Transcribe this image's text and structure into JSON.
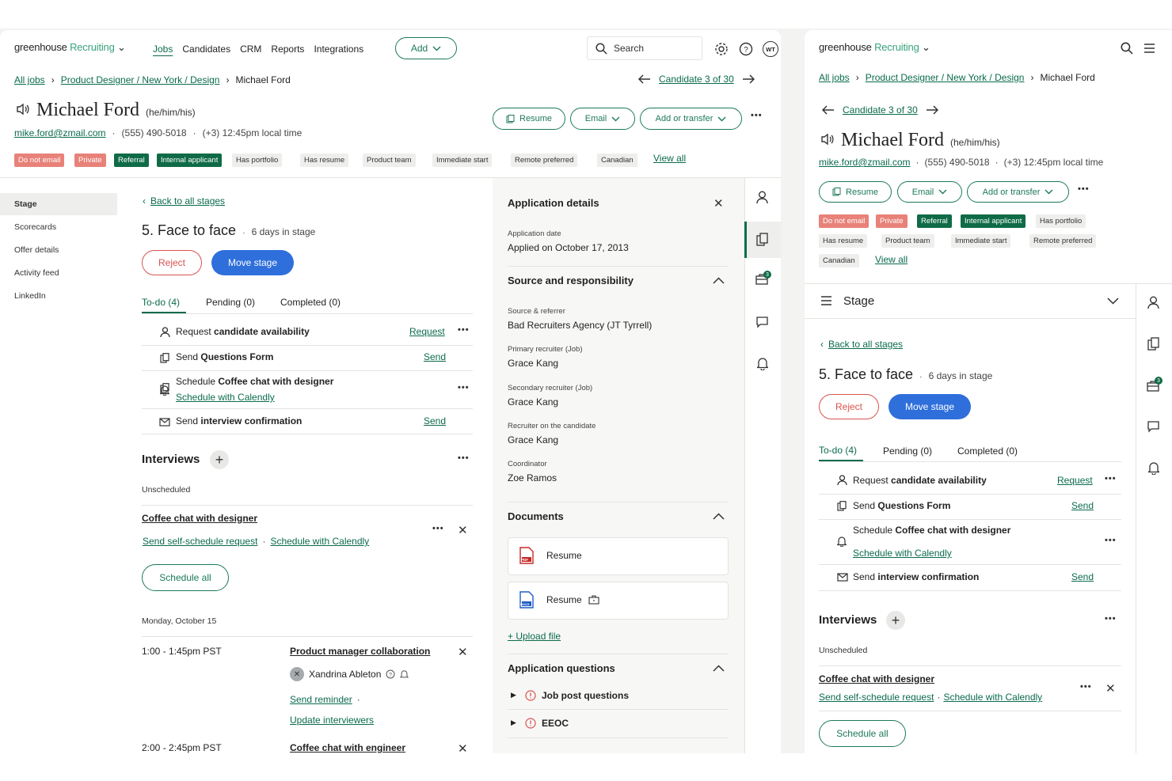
{
  "app": {
    "brand": "greenhouse",
    "product": "Recruiting"
  },
  "nav": {
    "jobs": "Jobs",
    "candidates": "Candidates",
    "crm": "CRM",
    "reports": "Reports",
    "integrations": "Integrations",
    "add": "Add",
    "search_placeholder": "Search",
    "user_initials": "WT"
  },
  "breadcrumb": {
    "all_jobs": "All jobs",
    "job": "Product Designer / New York / Design",
    "current": "Michael Ford"
  },
  "pager": {
    "label": "Candidate 3 of 30"
  },
  "candidate": {
    "name": "Michael Ford",
    "pronouns": "(he/him/his)",
    "email": "mike.ford@zmail.com",
    "phone": "(555) 490-5018",
    "local_time": "(+3) 12:45pm local time",
    "sep": "·"
  },
  "actions": {
    "resume": "Resume",
    "email": "Email",
    "add_transfer": "Add or transfer",
    "more": "•••"
  },
  "tags": [
    {
      "label": "Do not email",
      "style": "red"
    },
    {
      "label": "Private",
      "style": "red"
    },
    {
      "label": "Referral",
      "style": "green"
    },
    {
      "label": "Internal applicant",
      "style": "green"
    },
    {
      "label": "Has portfolio",
      "style": "gray"
    },
    {
      "label": "Has resume",
      "style": "gray"
    },
    {
      "label": "Product team",
      "style": "gray"
    },
    {
      "label": "Immediate start",
      "style": "gray"
    },
    {
      "label": "Remote preferred",
      "style": "gray"
    },
    {
      "label": "Canadian",
      "style": "gray"
    }
  ],
  "view_all": "View all",
  "sidebar": {
    "items": [
      "Stage",
      "Scorecards",
      "Offer details",
      "Activity feed",
      "LinkedIn"
    ]
  },
  "stage": {
    "back": "Back to all stages",
    "title": "5. Face to face",
    "days": "6 days in stage",
    "reject": "Reject",
    "move": "Move stage",
    "section": "Stage"
  },
  "tabs": {
    "todo": "To-do (4)",
    "pending": "Pending (0)",
    "completed": "Completed (0)"
  },
  "todos": [
    {
      "pre": "Request ",
      "bold": "candidate availability",
      "action": "Request"
    },
    {
      "pre": "Send ",
      "bold": "Questions Form",
      "action": "Send"
    },
    {
      "pre": "Schedule ",
      "bold": "Coffee chat with designer",
      "action": "Schedule with Calendly"
    },
    {
      "pre": "Send ",
      "bold": "interview confirmation",
      "action": "Send"
    }
  ],
  "interviews": {
    "title": "Interviews",
    "unscheduled": "Unscheduled",
    "coffee": "Coffee chat with designer",
    "self_schedule": "Send self-schedule request",
    "calendly": "Schedule with Calendly",
    "schedule_all": "Schedule all",
    "date": "Monday, October 15",
    "slot1_time": "1:00 - 1:45pm PST",
    "slot1_title": "Product manager collaboration",
    "interviewer": "Xandrina Ableton",
    "reminder": "Send reminder",
    "update": "Update interviewers",
    "slot2_time": "2:00 - 2:45pm PST",
    "slot2_title": "Coffee chat with engineer"
  },
  "details": {
    "title": "Application details",
    "app_date_label": "Application date",
    "app_date": "Applied on October 17, 2013",
    "source_title": "Source and responsibility",
    "source_label": "Source & referrer",
    "source": "Bad Recruiters Agency (JT Tyrrell)",
    "primary_label": "Primary recruiter (Job)",
    "primary": "Grace Kang",
    "secondary_label": "Secondary recruiter (Job)",
    "secondary": "Grace Kang",
    "rec_cand_label": "Recruiter on the candidate",
    "rec_cand": "Grace Kang",
    "coord_label": "Coordinator",
    "coord": "Zoe Ramos",
    "docs_title": "Documents",
    "doc1": "Resume",
    "doc2": "Resume",
    "pdf_tag": "PDF",
    "docx_tag": "DOCX",
    "upload": "+ Upload file",
    "questions_title": "Application questions",
    "q1": "Job post questions",
    "q2": "EEOC"
  },
  "badge_count": "3",
  "colors": {
    "brand_green": "#0f6b47",
    "link_green": "#0b6b4e",
    "primary_blue": "#2f6fdb",
    "danger": "#d9534f"
  }
}
